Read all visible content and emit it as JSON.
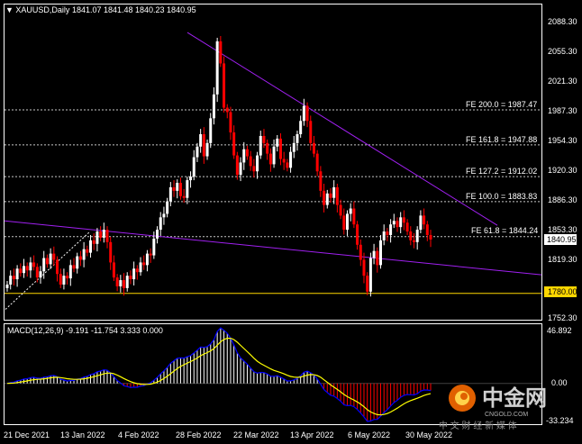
{
  "header": {
    "symbol": "XAUUSD,Daily",
    "ohlc": "1841.07 1841.48 1840.23 1840.95"
  },
  "price_axis": {
    "ticks": [
      "2088.30",
      "2055.30",
      "2021.30",
      "1987.30",
      "1954.30",
      "1920.30",
      "1886.30",
      "1853.30",
      "1819.30",
      "1780.00",
      "1752.30"
    ],
    "current_price": "1840.95",
    "level_label": "1780.00"
  },
  "fib_levels": [
    {
      "label": "FE 200.0 = 1987.47",
      "price": 1987.47
    },
    {
      "label": "FE 161.8 = 1947.88",
      "price": 1947.88
    },
    {
      "label": "FE 127.2 = 1912.02",
      "price": 1912.02
    },
    {
      "label": "FE 100.0 = 1883.83",
      "price": 1883.83
    },
    {
      "label": "FE 61.8 = 1844.24",
      "price": 1844.24
    }
  ],
  "time_axis": [
    "21 Dec 2021",
    "13 Jan 2022",
    "4 Feb 2022",
    "28 Feb 2022",
    "22 Mar 2022",
    "13 Apr 2022",
    "6 May 2022",
    "30 May 2022"
  ],
  "macd": {
    "label": "MACD(12,26,9) -9.191 -11.754 3.333 0.000",
    "top_tick": "46.892",
    "zero_tick": "0.00",
    "bottom_tick": "-33.234"
  },
  "watermark": {
    "brand": "中金网",
    "domain": "CNGOLD.COM",
    "tagline": "中 文 财 经 新 媒 体"
  },
  "colors": {
    "background": "#000000",
    "bull": "#ffffff",
    "bear": "#ff0000",
    "trendline": "#a020f0",
    "level_line": "#ffd700",
    "signal_line": "#ffff00",
    "macd_line": "#0000ff"
  },
  "chart_data": {
    "type": "candlestick",
    "symbol": "XAUUSD",
    "timeframe": "Daily",
    "ylim": [
      1745,
      2095
    ],
    "closes": [
      1790,
      1800,
      1796,
      1808,
      1803,
      1811,
      1806,
      1815,
      1810,
      1798,
      1805,
      1820,
      1813,
      1825,
      1818,
      1802,
      1790,
      1800,
      1797,
      1812,
      1808,
      1822,
      1818,
      1830,
      1826,
      1840,
      1836,
      1850,
      1843,
      1852,
      1838,
      1815,
      1798,
      1788,
      1795,
      1786,
      1800,
      1796,
      1808,
      1804,
      1815,
      1812,
      1825,
      1823,
      1842,
      1852,
      1866,
      1870,
      1884,
      1900,
      1896,
      1905,
      1890,
      1888,
      1908,
      1912,
      1934,
      1946,
      1960,
      1935,
      1950,
      1978,
      2005,
      2065,
      2040,
      1990,
      1985,
      1962,
      1936,
      1914,
      1928,
      1943,
      1935,
      1924,
      1918,
      1936,
      1958,
      1950,
      1938,
      1926,
      1946,
      1955,
      1932,
      1928,
      1922,
      1940,
      1950,
      1960,
      1975,
      1992,
      1975,
      1950,
      1938,
      1918,
      1896,
      1880,
      1893,
      1888,
      1900,
      1880,
      1868,
      1852,
      1870,
      1876,
      1858,
      1835,
      1818,
      1800,
      1782,
      1820,
      1828,
      1812,
      1840,
      1850,
      1846,
      1858,
      1862,
      1855,
      1866,
      1860,
      1850,
      1840,
      1838,
      1852,
      1868,
      1858,
      1846,
      1840.95
    ],
    "macd": {
      "histogram_range": [
        -33.234,
        46.892
      ]
    }
  }
}
